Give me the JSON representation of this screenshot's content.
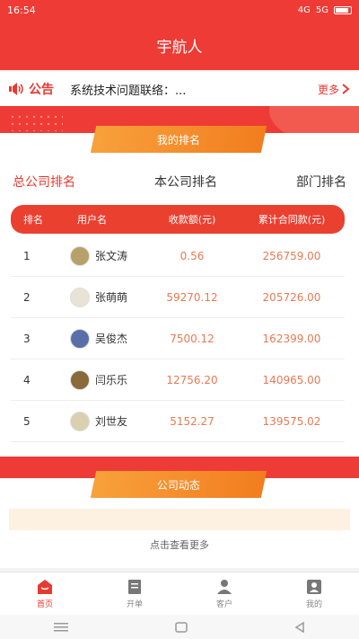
{
  "status": {
    "time": "16:54",
    "network": "4G",
    "signal": "5G"
  },
  "header": {
    "title": "宇航人"
  },
  "notice": {
    "badge": "公告",
    "text": "系统技术问题联络：...",
    "more": "更多"
  },
  "ranking": {
    "title": "我的排名",
    "tabs": [
      "总公司排名",
      "本公司排名",
      "部门排名"
    ],
    "columns": [
      "排名",
      "用户名",
      "收款额(元)",
      "累计合同款(元)"
    ],
    "rows": [
      {
        "rank": "1",
        "name": "张文涛",
        "amount": "0.56",
        "total": "256759.00"
      },
      {
        "rank": "2",
        "name": "张萌萌",
        "amount": "59270.12",
        "total": "205726.00"
      },
      {
        "rank": "3",
        "name": "吴俊杰",
        "amount": "7500.12",
        "total": "162399.00"
      },
      {
        "rank": "4",
        "name": "闫乐乐",
        "amount": "12756.20",
        "total": "140965.00"
      },
      {
        "rank": "5",
        "name": "刘世友",
        "amount": "5152.27",
        "total": "139575.02"
      }
    ]
  },
  "news": {
    "title": "公司动态",
    "more": "点击查看更多"
  },
  "tabbar": [
    "首页",
    "开单",
    "客户",
    "我的"
  ],
  "colors": {
    "primary": "#ee3b35",
    "accent": "#f27d1f",
    "value": "#e87a53"
  }
}
